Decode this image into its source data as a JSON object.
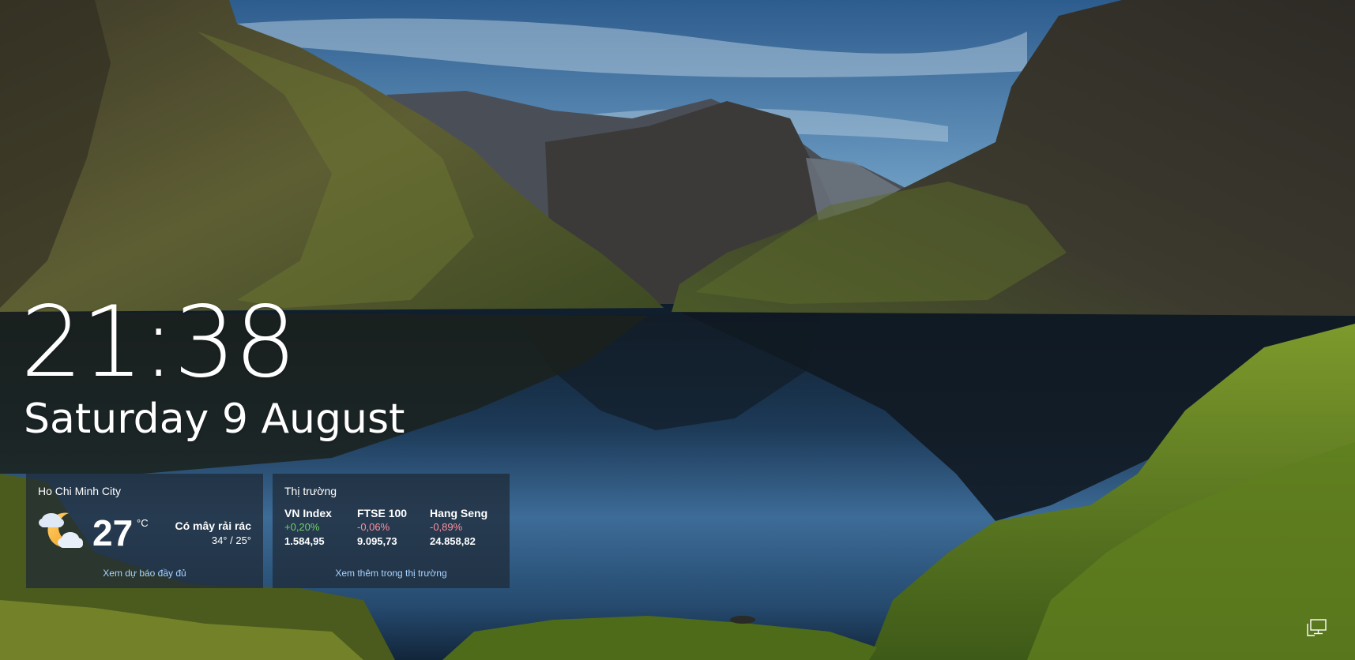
{
  "clock": {
    "time": "21:38",
    "date": "Saturday 9 August"
  },
  "weather": {
    "city": "Ho Chi Minh City",
    "icon": "partly-cloudy-night-icon",
    "temperature": "27",
    "unit": "°C",
    "condition": "Có mây rải rác",
    "high_low": "34° / 25°",
    "link": "Xem dự báo đầy đủ"
  },
  "market": {
    "title": "Thị trường",
    "indices": [
      {
        "name": "VN Index",
        "change": "+0,20%",
        "value": "1.584,95",
        "direction": "up"
      },
      {
        "name": "FTSE 100",
        "change": "-0,06%",
        "value": "9.095,73",
        "direction": "down"
      },
      {
        "name": "Hang Seng",
        "change": "-0,89%",
        "value": "24.858,82",
        "direction": "down"
      }
    ],
    "link": "Xem thêm trong thị trường"
  },
  "system": {
    "network_icon": "network-icon"
  },
  "colors": {
    "up": "#6fd36a",
    "down": "#ff8f9f",
    "link": "#a9d4ff",
    "card_bg": "rgba(30,40,52,0.72)"
  }
}
